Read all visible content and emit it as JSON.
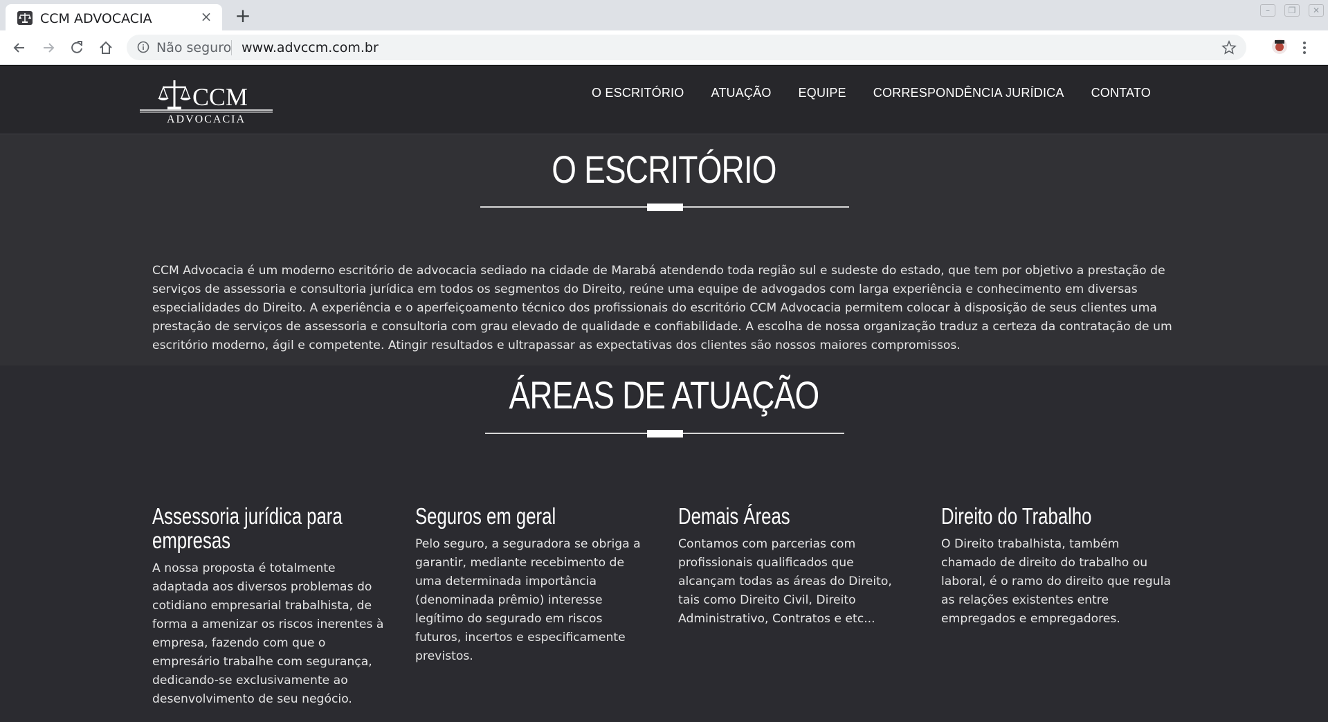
{
  "browser": {
    "tab_title": "CCM ADVOCACIA",
    "tab_close": "×",
    "new_tab": "+",
    "security_label": "Não seguro",
    "url": "www.advccm.com.br"
  },
  "site": {
    "logo_text": "CCM",
    "logo_subtext": "ADVOCACIA",
    "nav": [
      {
        "label": "O ESCRITÓRIO"
      },
      {
        "label": "ATUAÇÃO"
      },
      {
        "label": "EQUIPE"
      },
      {
        "label": "CORRESPONDÊNCIA JURÍDICA"
      },
      {
        "label": "CONTATO"
      }
    ],
    "escritorio": {
      "title": "O ESCRITÓRIO",
      "text": "CCM Advocacia é um moderno escritório de advocacia sediado na cidade de Marabá atendendo toda região sul e sudeste do estado, que tem por objetivo a prestação de serviços de assessoria e consultoria jurídica em todos os segmentos do Direito, reúne uma equipe de advogados com larga experiência e conhecimento em diversas especialidades do Direito. A experiência e o aperfeiçoamento técnico dos profissionais do escritório CCM Advocacia permitem colocar à disposição de seus clientes uma prestação de serviços de assessoria e consultoria com grau elevado de qualidade e confiabilidade. A escolha de nossa organização traduz a certeza da contratação de um escritório moderno, ágil e competente. Atingir resultados e ultrapassar as expectativas dos clientes são nossos maiores compromissos."
    },
    "areas": {
      "title": "ÁREAS DE ATUAÇÃO",
      "cards": [
        {
          "title": "Assessoria jurídica para empresas",
          "text": "A nossa proposta é totalmente adaptada aos diversos problemas do cotidiano empresarial trabalhista, de forma a amenizar os riscos inerentes à empresa, fazendo com que o empresário trabalhe com segurança, dedicando-se exclusivamente ao desenvolvimento de seu negócio."
        },
        {
          "title": "Seguros em geral",
          "text": "Pelo seguro, a seguradora se obriga a garantir, mediante recebimento de uma determinada importância (denominada prêmio) interesse legítimo do segurado em riscos futuros, incertos e especificamente previstos."
        },
        {
          "title": "Demais Áreas",
          "text": "Contamos com parcerias com profissionais qualificados que alcançam todas as áreas do Direito, tais como Direito Civil, Direito Administrativo, Contratos e etc..."
        },
        {
          "title": "Direito do Trabalho",
          "text": "O Direito trabalhista, também chamado de direito do trabalho ou laboral, é o ramo do direito que regula as relações existentes entre empregados e empregadores."
        }
      ]
    }
  }
}
